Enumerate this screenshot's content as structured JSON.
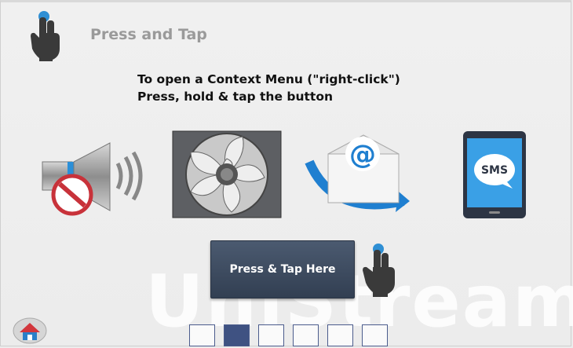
{
  "header": {
    "title": "Press and Tap",
    "icon": "hand-tap-icon"
  },
  "instructions": {
    "line1": "To open a Context Menu (\"right-click\")",
    "line2": "Press, hold & tap the button"
  },
  "feature_icons": [
    "mute-speaker-icon",
    "fan-icon",
    "email-at-icon",
    "sms-phone-icon"
  ],
  "sms_label": "SMS",
  "action_button": {
    "label": "Press & Tap Here"
  },
  "watermark": "UniStream",
  "pager": {
    "count": 6,
    "active_index": 1
  },
  "home_button": {
    "icon": "home-icon"
  },
  "colors": {
    "button_bg": "#3b4a5f",
    "pager_active": "#3f5282",
    "title_gray": "#9a9a9a",
    "blue_accent": "#2b8fd8"
  }
}
